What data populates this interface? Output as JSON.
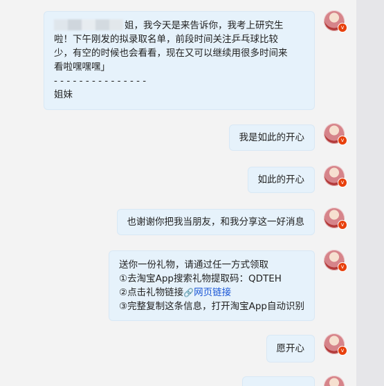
{
  "messages": [
    {
      "type": "long",
      "lines": [
        "姐，我今天是来告诉你，我考上研究生",
        "啦！下午刚发的拟录取名单，前段时间关注乒乓球比较",
        "少，有空的时候也会看看，现在又可以继续用很多时间来",
        "看啦嘿嘿嘿」",
        "- - - - - - - - - - - - - - -",
        "姐妹"
      ]
    },
    {
      "type": "short",
      "text": "我是如此的开心"
    },
    {
      "type": "short",
      "text": "如此的开心"
    },
    {
      "type": "short",
      "text": "也谢谢你把我当朋友，和我分享这一好消息"
    },
    {
      "type": "gift",
      "line1": "送你一份礼物，请通过任一方式领取",
      "line2": "①去淘宝App搜索礼物提取码：QDTEH",
      "line3_prefix": "②点击礼物链接",
      "line3_link": "网页链接",
      "line4": "③完整复制这条信息，打开淘宝App自动识别"
    },
    {
      "type": "short",
      "text": "愿开心"
    }
  ],
  "avatar_badge": "v"
}
